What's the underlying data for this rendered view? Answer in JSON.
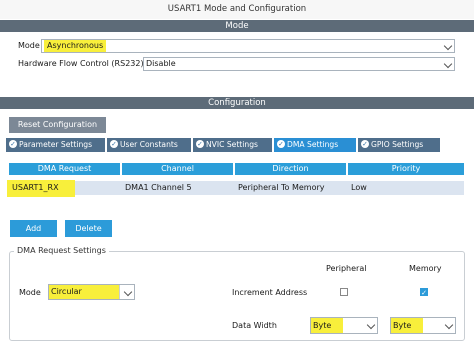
{
  "window": {
    "title": "USART1 Mode and Configuration"
  },
  "mode_section": {
    "header": "Mode",
    "mode_label": "Mode",
    "mode_value": "Asynchronous",
    "flow_label": "Hardware Flow Control (RS232)",
    "flow_value": "Disable"
  },
  "config_section": {
    "header": "Configuration",
    "reset_button": "Reset Configuration"
  },
  "tabs": [
    {
      "label": "Parameter Settings",
      "active": false
    },
    {
      "label": "User Constants",
      "active": false
    },
    {
      "label": "NVIC Settings",
      "active": false
    },
    {
      "label": "DMA Settings",
      "active": true
    },
    {
      "label": "GPIO Settings",
      "active": false
    }
  ],
  "dma_table": {
    "columns": [
      "DMA Request",
      "Channel",
      "Direction",
      "Priority"
    ],
    "rows": [
      {
        "request": "USART1_RX",
        "channel": "DMA1 Channel 5",
        "direction": "Peripheral To Memory",
        "priority": "Low"
      }
    ]
  },
  "buttons": {
    "add": "Add",
    "delete": "Delete"
  },
  "request_settings": {
    "legend": "DMA Request Settings",
    "peripheral_header": "Peripheral",
    "memory_header": "Memory",
    "mode_label": "Mode",
    "mode_value": "Circular",
    "increment_label": "Increment Address",
    "peripheral_increment": false,
    "memory_increment": true,
    "data_width_label": "Data Width",
    "peripheral_width": "Byte",
    "memory_width": "Byte"
  },
  "colors": {
    "section_bar": "#5d6b78",
    "tab_bar": "#4f6e8b",
    "tab_active": "#2a8fd4",
    "table_header": "#2b9ed9",
    "selected_row": "#dbe4f0",
    "highlight": "#f8ef3b"
  }
}
